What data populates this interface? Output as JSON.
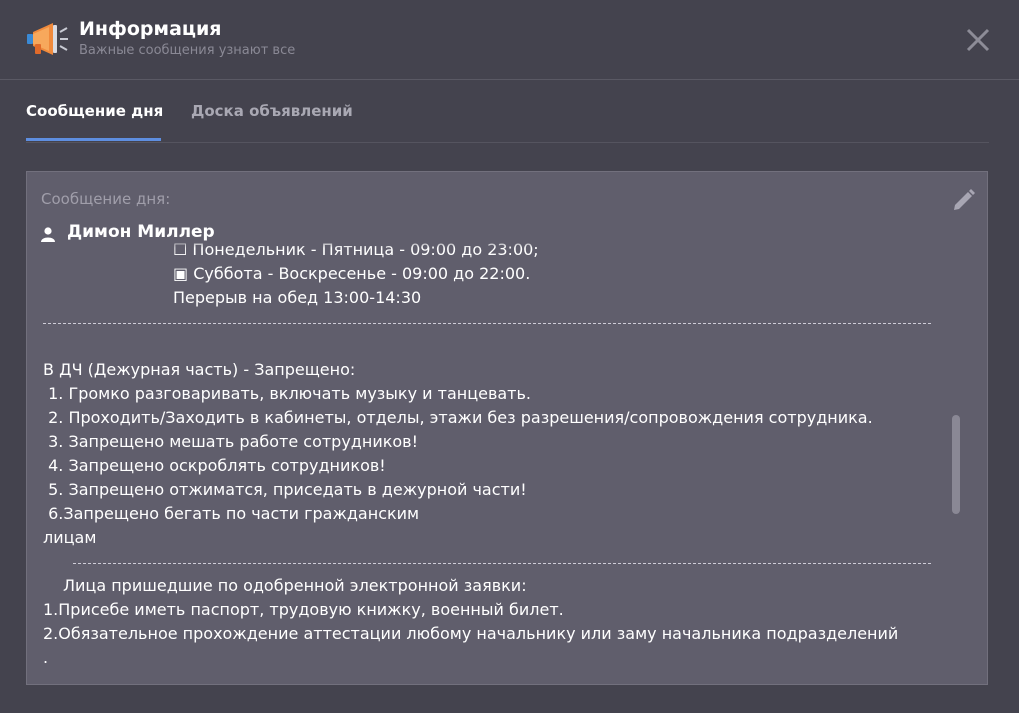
{
  "header": {
    "title": "Информация",
    "subtitle": "Важные сообщения узнают все",
    "icon": "megaphone-icon"
  },
  "tabs": [
    {
      "label": "Сообщение дня",
      "active": true
    },
    {
      "label": "Доска объявлений",
      "active": false
    }
  ],
  "colors": {
    "background": "#44434e",
    "panel": "#605e6c",
    "accent": "#5e8ee0"
  },
  "message": {
    "label": "Сообщение дня:",
    "author": "Димон Миллер",
    "lines": [
      "☐ Понедельник - Пятница - 09:00 до 23:00;",
      "▣ Суббота - Воскресенье - 09:00 до 22:00.",
      "Перерыв на обед 13:00-14:30",
      "В ДЧ (Дежурная часть) - Запрещено:",
      " 1. Громко разговаривать, включать музыку и танцевать.",
      " 2. Проходить/Заходить в кабинеты, отделы, этажи без разрешения/сопровождения сотрудника.",
      " 3. Запрещено мешать работе сотрудников!",
      " 4. Запрещено оскроблять сотрудников!",
      " 5. Запрещено отжиматся, приседать в дежурной части!",
      " 6.Запрещено бегать по части гражданским",
      "лицам",
      "Лица пришедшие по одобренной электронной заявки:",
      "1.Присебе иметь паспорт, трудовую книжку, военный билет.",
      "2.Обязательное прохождение аттестации любому начальнику или заму начальника подразделений",
      "."
    ]
  }
}
